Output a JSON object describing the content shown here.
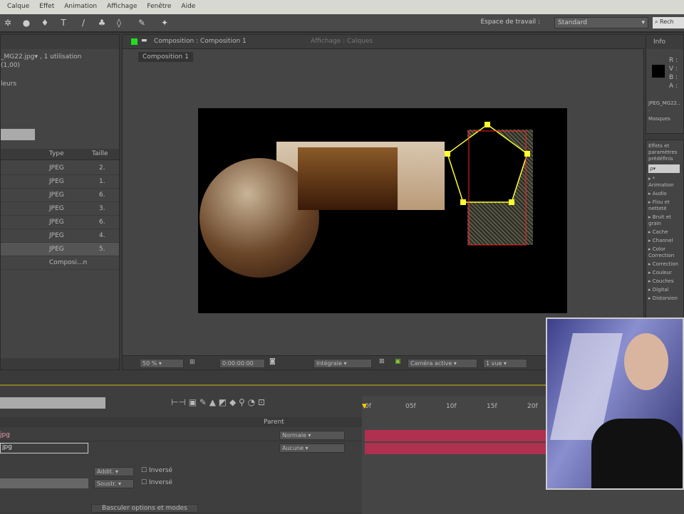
{
  "menu": [
    "Calque",
    "Effet",
    "Animation",
    "Affichage",
    "Fenêtre",
    "Aide"
  ],
  "toolbar": {
    "workspace_label": "Espace de travail :",
    "workspace_value": "Standard",
    "search_placeholder": "Rech"
  },
  "project": {
    "file_name": "_MG22.jpg",
    "usage": "▾ , 1 utilisation",
    "line2": "(1,00)",
    "line3": "leurs",
    "columns": {
      "type": "Type",
      "size": "Taille"
    },
    "rows": [
      {
        "type": "JPEG",
        "size": "2."
      },
      {
        "type": "JPEG",
        "size": "1."
      },
      {
        "type": "JPEG",
        "size": "6."
      },
      {
        "type": "JPEG",
        "size": "3."
      },
      {
        "type": "JPEG",
        "size": "6."
      },
      {
        "type": "JPEG",
        "size": "4."
      },
      {
        "type": "JPEG",
        "size": "5."
      },
      {
        "type": "Composi...n",
        "size": ""
      }
    ]
  },
  "viewer": {
    "tab": "Composition : Composition 1",
    "tab2": "Affichage : Calques",
    "crumb": "Composition 1",
    "zoom": "50 %",
    "timecode": "0:00:00:00",
    "resolution": "Intégrale",
    "camera": "Caméra active",
    "views": "1 vue"
  },
  "info": {
    "title": "Info",
    "channels": [
      "R :",
      "V :",
      "B :",
      "A :"
    ],
    "file": "JPEG_MG22...",
    "mask": "Masques"
  },
  "effects": {
    "title": "Effets et paramètres prédéfinis",
    "search": "ρ▾",
    "items": [
      "* Animation",
      "Audio",
      "Flou et netteté",
      "Bruit et grain",
      "Cache",
      "Channel",
      "Color Correction",
      "Correction",
      "Couleur",
      "Couches",
      "Digital",
      "Distorsion"
    ]
  },
  "timeline": {
    "ruler": [
      "0f",
      "05f",
      "10f",
      "15f",
      "20f"
    ],
    "parent_header": "Parent",
    "layers": [
      {
        "mode": "Normale"
      },
      {
        "mode": "Aucune"
      }
    ],
    "masks": [
      {
        "mode": "Addit.",
        "inv": "Inversé"
      },
      {
        "mode": "Soustr.",
        "inv": "Inversé"
      }
    ],
    "toggle": "Basculer options et modes"
  },
  "colors": {
    "accent": "#8a7a2a",
    "mask_yellow": "#ffff30",
    "mask_red": "#ff2020",
    "layer_bar": "#b03050"
  }
}
